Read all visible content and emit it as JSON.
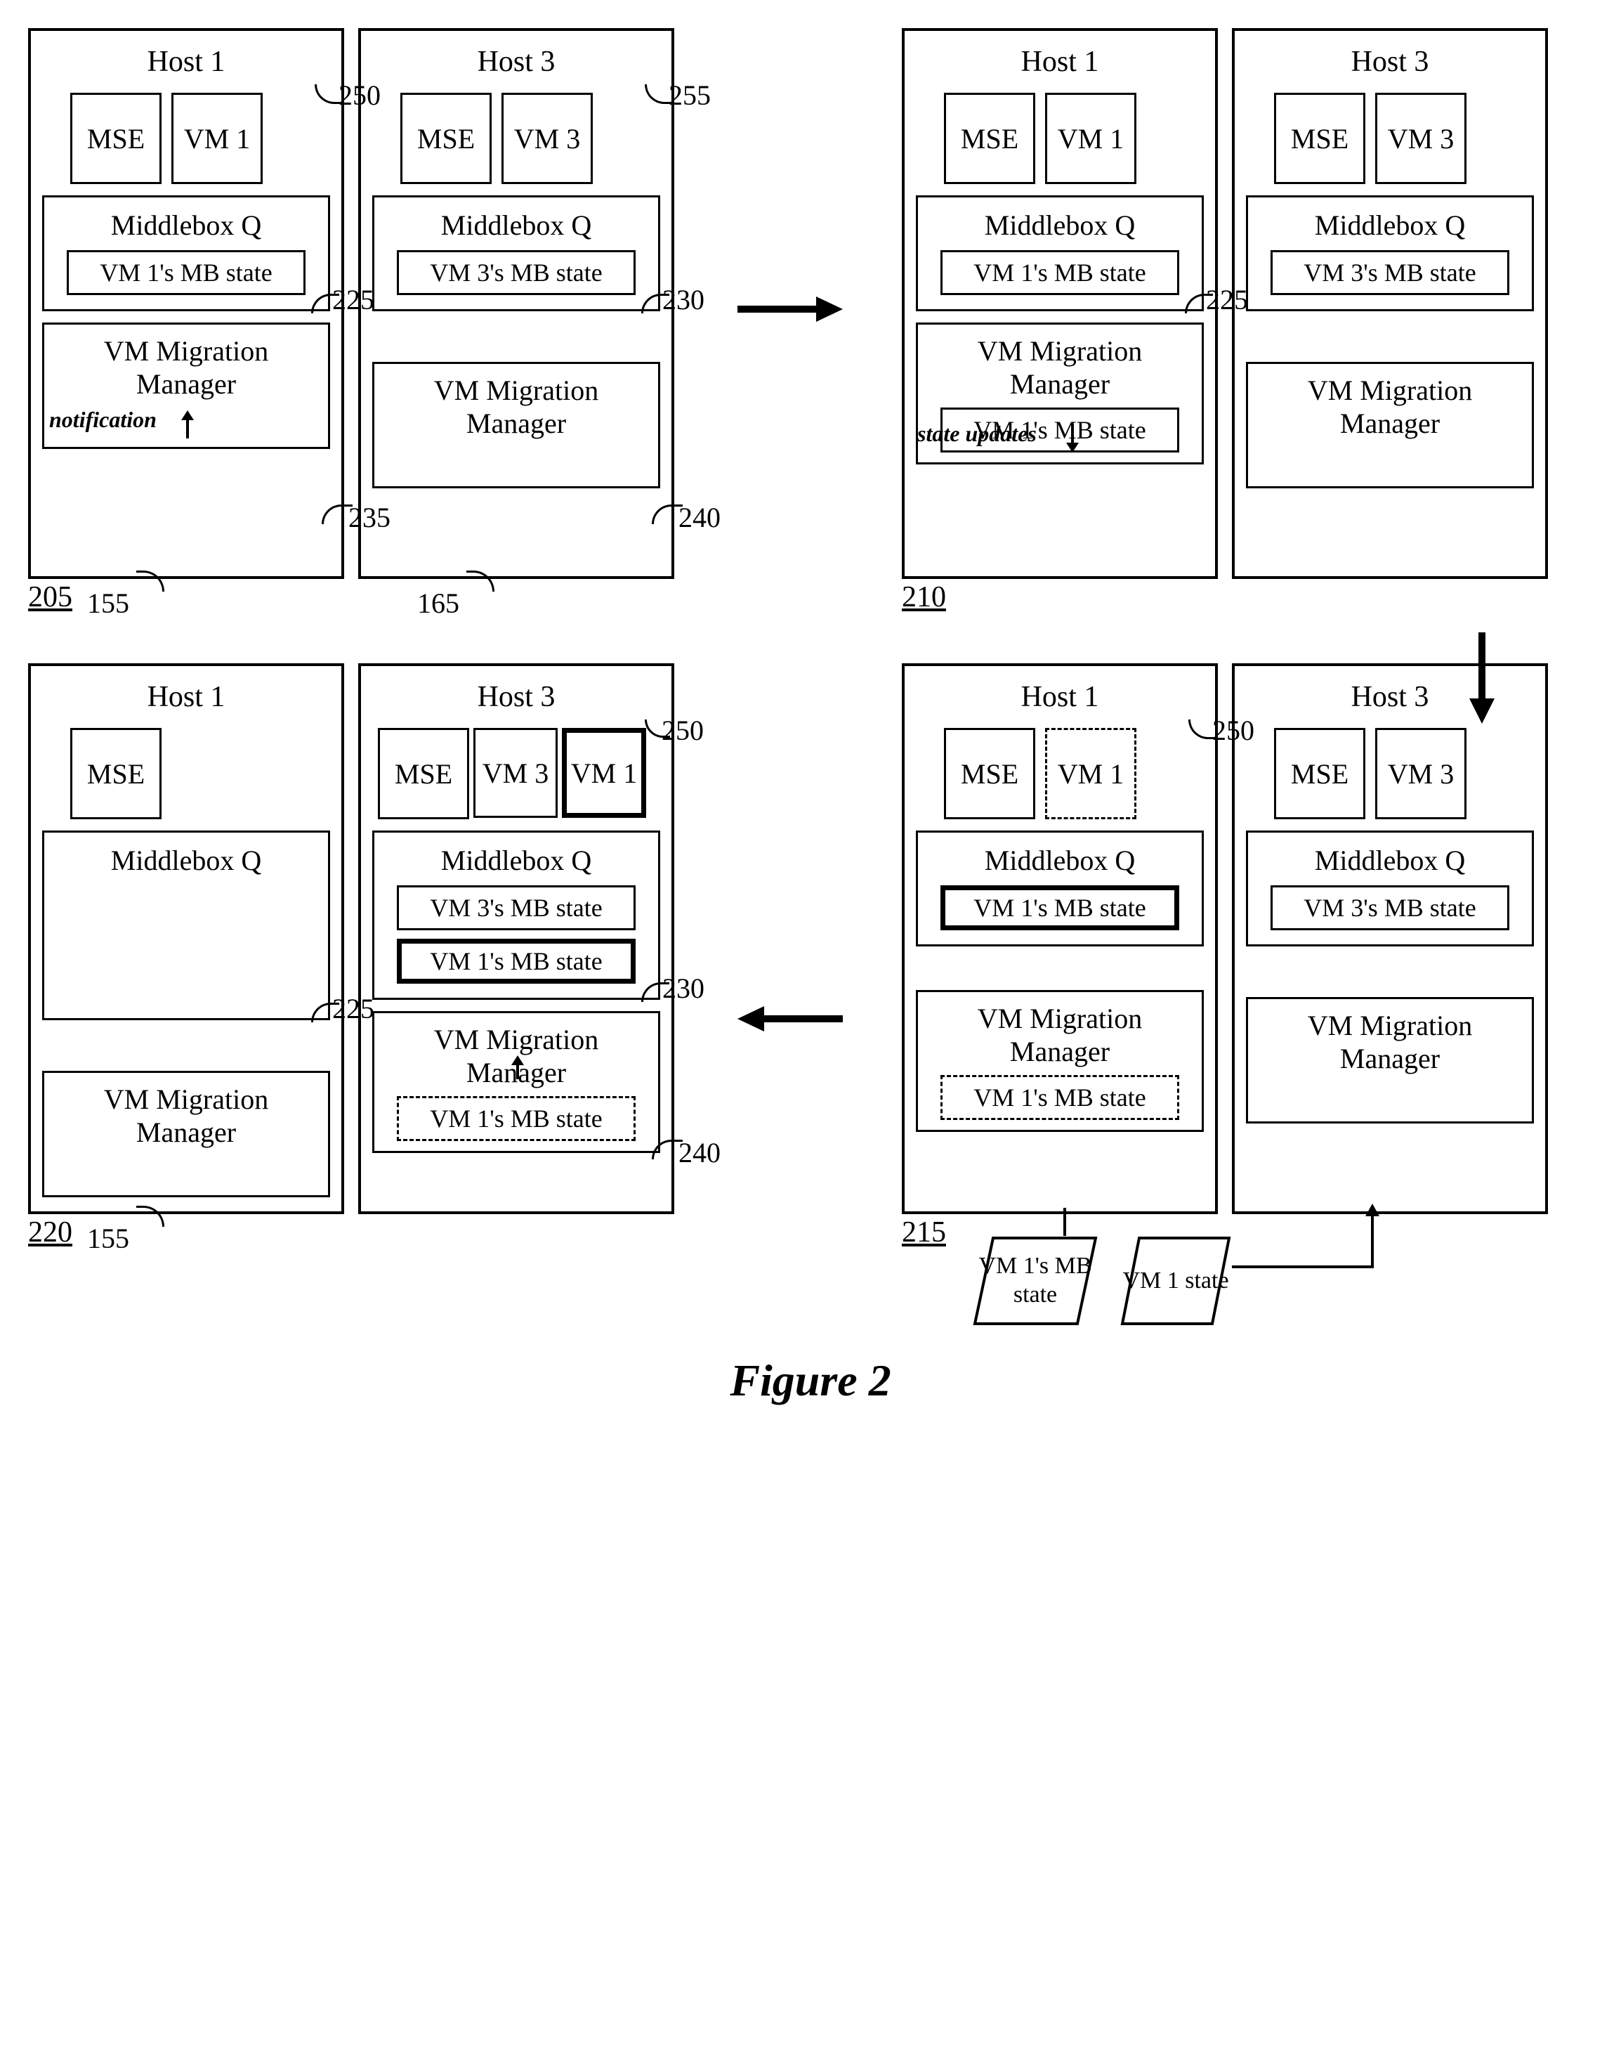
{
  "figure_label": "Figure 2",
  "labels": {
    "mse": "MSE",
    "vm1": "VM 1",
    "vm3": "VM 3",
    "host1": "Host 1",
    "host3": "Host 3",
    "middleboxQ": "Middlebox Q",
    "vm1_mb_state": "VM 1's MB state",
    "vm3_mb_state": "VM 3's MB state",
    "vm_migration_manager": "VM Migration Manager",
    "notification": "notification",
    "state_updates": "state updates",
    "vm1_state": "VM 1 state",
    "vm1_mb_state_ml": "VM 1's MB state"
  },
  "refs": {
    "n155": "155",
    "n165": "165",
    "n205": "205",
    "n210": "210",
    "n215": "215",
    "n220": "220",
    "n225": "225",
    "n230": "230",
    "n235": "235",
    "n240": "240",
    "n250": "250",
    "n255": "255"
  }
}
